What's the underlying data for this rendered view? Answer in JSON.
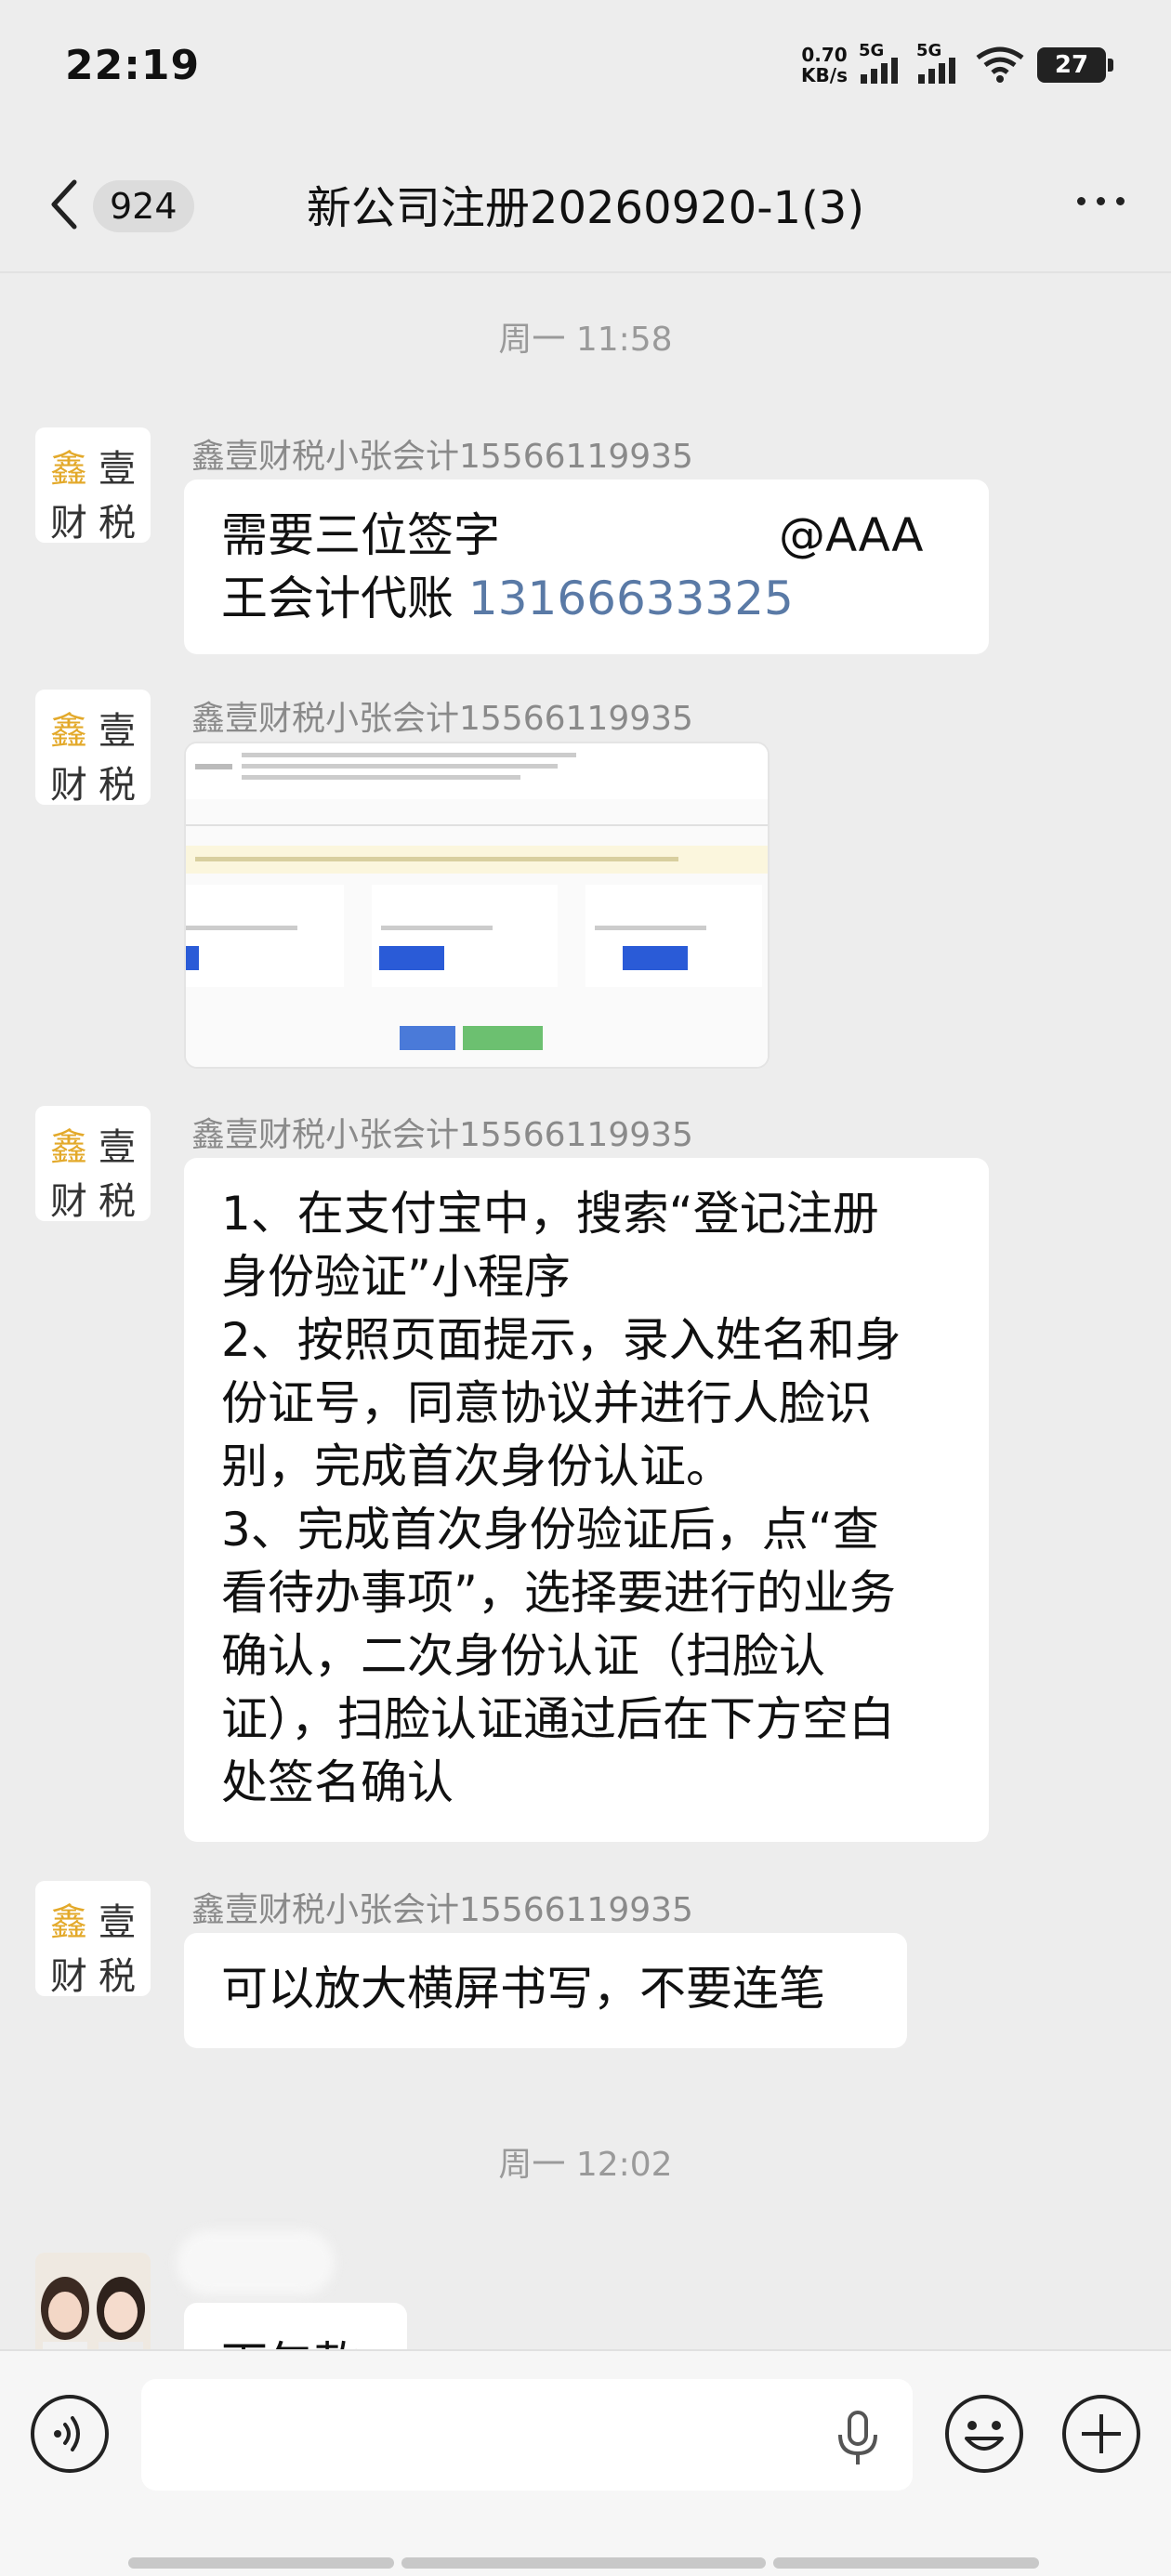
{
  "status_bar": {
    "time": "22:19",
    "net_speed_value": "0.70",
    "net_speed_unit": "KB/s",
    "signal1_label": "5G",
    "signal2_label": "5G",
    "battery": "27"
  },
  "header": {
    "unread_count": "924",
    "title": "新公司注册20260920-1(3)"
  },
  "timestamps": [
    "周一 11:58",
    "周一 12:02"
  ],
  "brand_avatar": {
    "chars": [
      "鑫",
      "壹",
      "财",
      "税"
    ]
  },
  "messages": [
    {
      "sender": "鑫壹财税小张会计15566119935",
      "line1": "需要三位签字",
      "mention": "@AAA",
      "line2_prefix": "王会计代账 ",
      "phone": "13166633325"
    },
    {
      "sender": "鑫壹财税小张会计15566119935",
      "type": "image"
    },
    {
      "sender": "鑫壹财税小张会计15566119935",
      "lines": [
        "1、在支付宝中，搜索“登记注册",
        "身份验证”小程序",
        "2、按照页面提示，录入姓名和身",
        "份证号，同意协议并进行人脸识",
        "别，完成首次身份认证。",
        "3、完成首次身份验证后，点“查",
        "看待办事项”，选择要进行的业务",
        "确认，二次身份认证（扫脸认",
        "证），扫脸认证通过后在下方空白",
        "处签名确认"
      ]
    },
    {
      "sender": "鑫壹财税小张会计15566119935",
      "text": "可以放大横屏书写，不要连笔"
    },
    {
      "partial_text": "下午款"
    }
  ],
  "input": {
    "placeholder": ""
  },
  "colors": {
    "background": "#ededed",
    "bubble": "#ffffff",
    "phone_link": "#5a7aa6",
    "brand_gold": "#e3a92a"
  },
  "icons": [
    "back-arrow-icon",
    "more-icon",
    "voice-icon",
    "mic-icon",
    "emoji-icon",
    "plus-icon",
    "wifi-icon",
    "signal-icon",
    "battery-icon"
  ]
}
